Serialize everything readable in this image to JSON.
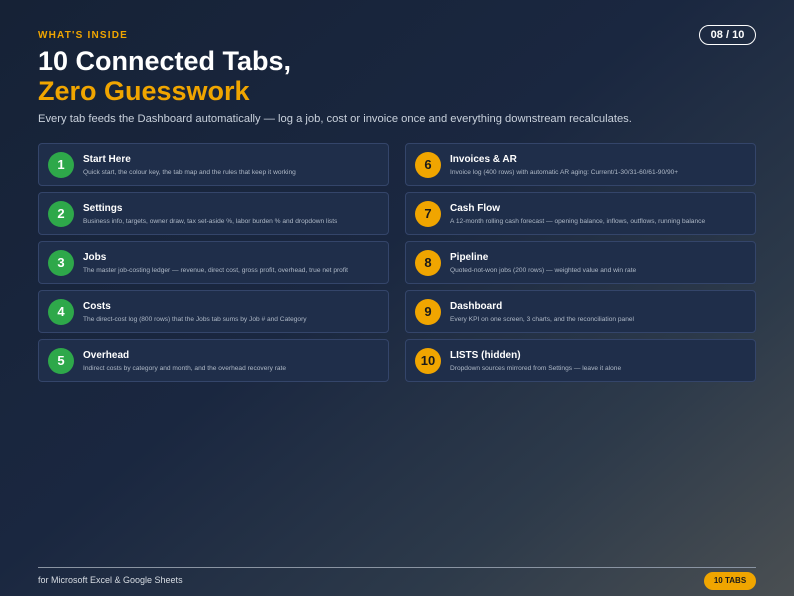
{
  "header": {
    "eyebrow": "WHAT'S INSIDE",
    "counter": "08 / 10",
    "title_line1": "10 Connected Tabs,",
    "title_line2": "Zero Guesswork",
    "subtitle": "Every tab feeds the Dashboard automatically — log a job, cost or invoice once and everything downstream recalculates."
  },
  "colors": {
    "accent": "#f0a500",
    "green": "#2ea84a",
    "card_bg": "#1f2e4a"
  },
  "tabs": [
    {
      "num": "1",
      "title": "Start Here",
      "desc": "Quick start, the colour key, the tab map and the rules that keep it working"
    },
    {
      "num": "6",
      "title": "Invoices & AR",
      "desc": "Invoice log (400 rows) with automatic AR aging: Current/1-30/31-60/61-90/90+"
    },
    {
      "num": "2",
      "title": "Settings",
      "desc": "Business info, targets, owner draw, tax set-aside %, labor burden % and dropdown lists"
    },
    {
      "num": "7",
      "title": "Cash Flow",
      "desc": "A 12-month rolling cash forecast — opening balance, inflows, outflows, running balance"
    },
    {
      "num": "3",
      "title": "Jobs",
      "desc": "The master job-costing ledger — revenue, direct cost, gross profit, overhead, true net profit"
    },
    {
      "num": "8",
      "title": "Pipeline",
      "desc": "Quoted-not-won jobs (200 rows) — weighted value and win rate"
    },
    {
      "num": "4",
      "title": "Costs",
      "desc": "The direct-cost log (800 rows) that the Jobs tab sums by Job # and Category"
    },
    {
      "num": "9",
      "title": "Dashboard",
      "desc": "Every KPI on one screen, 3 charts, and the reconciliation panel"
    },
    {
      "num": "5",
      "title": "Overhead",
      "desc": "Indirect costs by category and month, and the overhead recovery rate"
    },
    {
      "num": "10",
      "title": "LISTS (hidden)",
      "desc": "Dropdown sources mirrored from Settings — leave it alone"
    }
  ],
  "footer": {
    "text": "for Microsoft Excel & Google Sheets",
    "pill": "10 TABS"
  }
}
